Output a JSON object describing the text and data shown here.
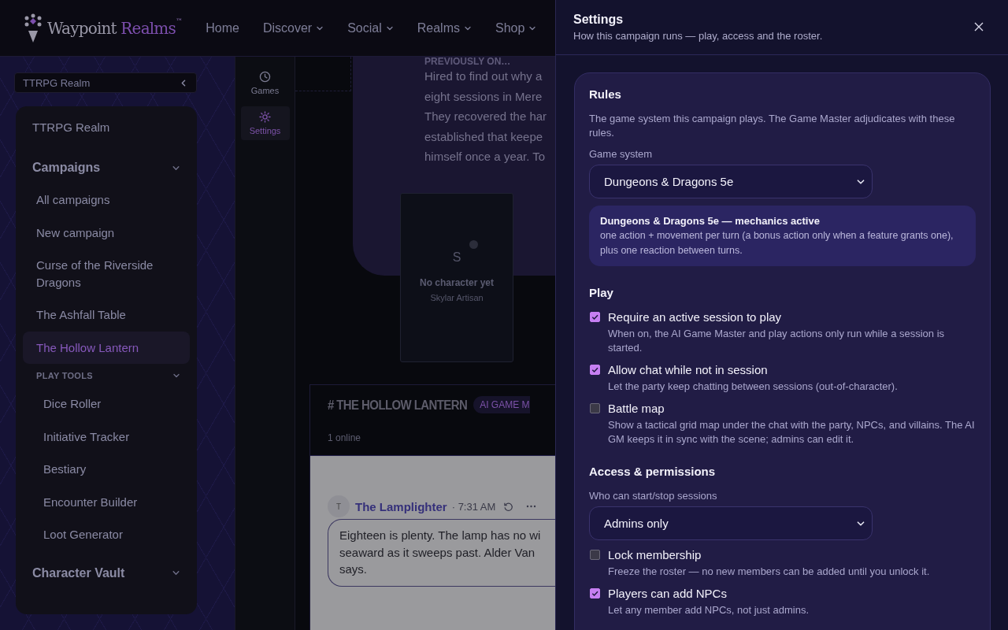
{
  "header": {
    "logo": {
      "text": "Waypoint",
      "accent": "Realms",
      "trademark": "™"
    },
    "nav": [
      {
        "label": "Home",
        "dropdown": false
      },
      {
        "label": "Discover",
        "dropdown": true
      },
      {
        "label": "Social",
        "dropdown": true
      },
      {
        "label": "Realms",
        "dropdown": true
      },
      {
        "label": "Shop",
        "dropdown": true
      }
    ]
  },
  "realm_select": {
    "value": "TTRPG Realm"
  },
  "sidebar": {
    "title": "TTRPG Realm",
    "groups": [
      {
        "label": "Campaigns",
        "kind": "section",
        "expanded": true,
        "items": [
          {
            "label": "All campaigns",
            "selected": false
          },
          {
            "label": "New campaign",
            "selected": false
          },
          {
            "label": "Curse of the Riverside Dragons",
            "selected": false
          },
          {
            "label": "The Ashfall Table",
            "selected": false
          },
          {
            "label": "The Hollow Lantern",
            "selected": true
          }
        ]
      },
      {
        "label": "PLAY TOOLS",
        "kind": "subsection",
        "expanded": true,
        "items": [
          {
            "label": "Dice Roller",
            "selected": false
          },
          {
            "label": "Initiative Tracker",
            "selected": false
          },
          {
            "label": "Bestiary",
            "selected": false
          },
          {
            "label": "Encounter Builder",
            "selected": false
          },
          {
            "label": "Loot Generator",
            "selected": false
          }
        ]
      },
      {
        "label": "Character Vault",
        "kind": "section",
        "expanded": true
      }
    ]
  },
  "rail": [
    {
      "label": "Games",
      "selected": false
    },
    {
      "label": "Settings",
      "selected": true
    }
  ],
  "recap": {
    "heading": "PREVIOUSLY ON…",
    "lines": [
      "Hired to find out why a",
      "eight sessions in Mere",
      "They recovered the har",
      "established that keepe",
      "himself once a year. To"
    ]
  },
  "character_card": {
    "initial": "S",
    "title": "No character yet",
    "player": "Skylar Artisan"
  },
  "chat": {
    "channel": "# THE HOLLOW LANTERN",
    "badge": "AI GAME M",
    "online": "1 online",
    "messages": [
      {
        "avatar": "T",
        "author": "The Lamplighter",
        "time": "· 7:31 AM",
        "lines": [
          "Eighteen is plenty. The lamp has no wi",
          "seaward as it sweeps past. Alder Van",
          "says."
        ]
      }
    ]
  },
  "drawer": {
    "title": "Settings",
    "subtitle": "How this campaign runs — play, access and the roster.",
    "sections": [
      {
        "heading": "Rules",
        "description": "The game system this campaign plays. The Game Master adjudicates with these rules.",
        "fields": [
          {
            "kind": "select",
            "label": "Game system",
            "value": "Dungeons & Dragons 5e"
          },
          {
            "kind": "info",
            "title": "Dungeons & Dragons 5e — mechanics active",
            "text": "one action + movement per turn (a bonus action only when a feature grants one), plus one reaction between turns."
          }
        ]
      },
      {
        "heading": "Play",
        "fields": [
          {
            "kind": "checkbox",
            "label": "Require an active session to play",
            "description": "When on, the AI Game Master and play actions only run while a session is started.",
            "checked": true
          },
          {
            "kind": "checkbox",
            "label": "Allow chat while not in session",
            "description": "Let the party keep chatting between sessions (out-of-character).",
            "checked": true
          },
          {
            "kind": "checkbox",
            "label": "Battle map",
            "description": "Show a tactical grid map under the chat with the party, NPCs, and villains. The AI GM keeps it in sync with the scene; admins can edit it.",
            "checked": false
          }
        ]
      },
      {
        "heading": "Access & permissions",
        "fields": [
          {
            "kind": "select",
            "label": "Who can start/stop sessions",
            "value": "Admins only"
          },
          {
            "kind": "checkbox",
            "label": "Lock membership",
            "description": "Freeze the roster — no new members can be added until you unlock it.",
            "checked": false
          },
          {
            "kind": "checkbox",
            "label": "Players can add NPCs",
            "description": "Let any member add NPCs, not just admins.",
            "checked": true
          }
        ]
      }
    ]
  }
}
